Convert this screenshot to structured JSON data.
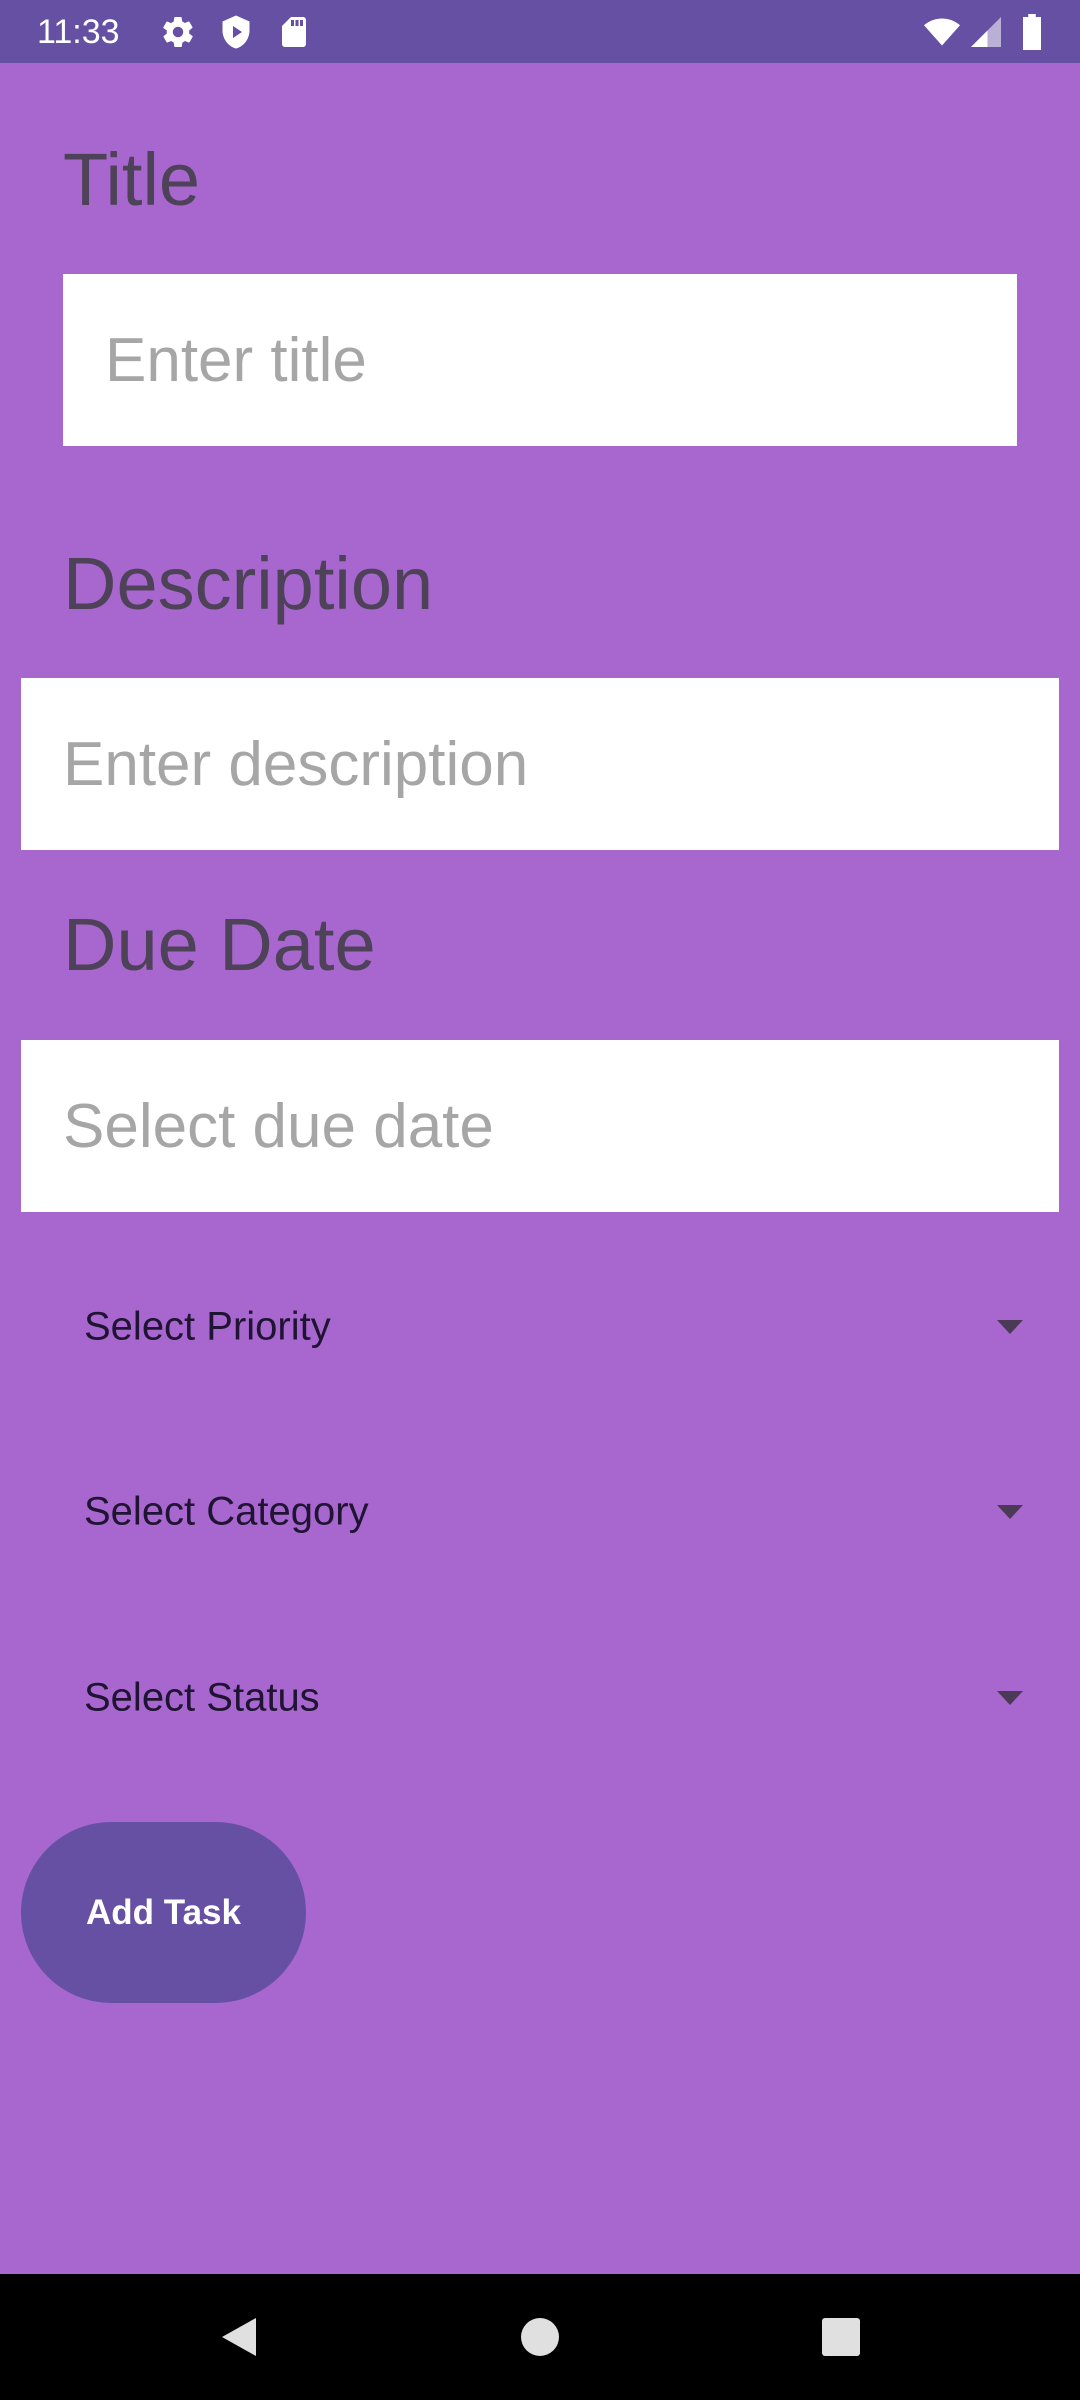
{
  "status_bar": {
    "time": "11:33",
    "icons": [
      "gear-icon",
      "shield-icon",
      "sd-card-icon",
      "wifi-icon",
      "signal-icon",
      "battery-icon"
    ]
  },
  "form": {
    "title_label": "Title",
    "title_placeholder": "Enter title",
    "title_value": "",
    "description_label": "Description",
    "description_placeholder": "Enter description",
    "description_value": "",
    "due_label": "Due Date",
    "due_placeholder": "Select due date",
    "due_value": "",
    "priority": "Select Priority",
    "category": "Select Category",
    "status": "Select Status",
    "add_button": "Add Task"
  },
  "colors": {
    "background": "#a866cf",
    "accent": "#6650a4",
    "label_text": "#4d4257",
    "input_bg": "#ffffff",
    "placeholder": "#a6a6a6"
  },
  "nav_bar": {
    "buttons": [
      "back-icon",
      "home-icon",
      "recents-icon"
    ]
  }
}
